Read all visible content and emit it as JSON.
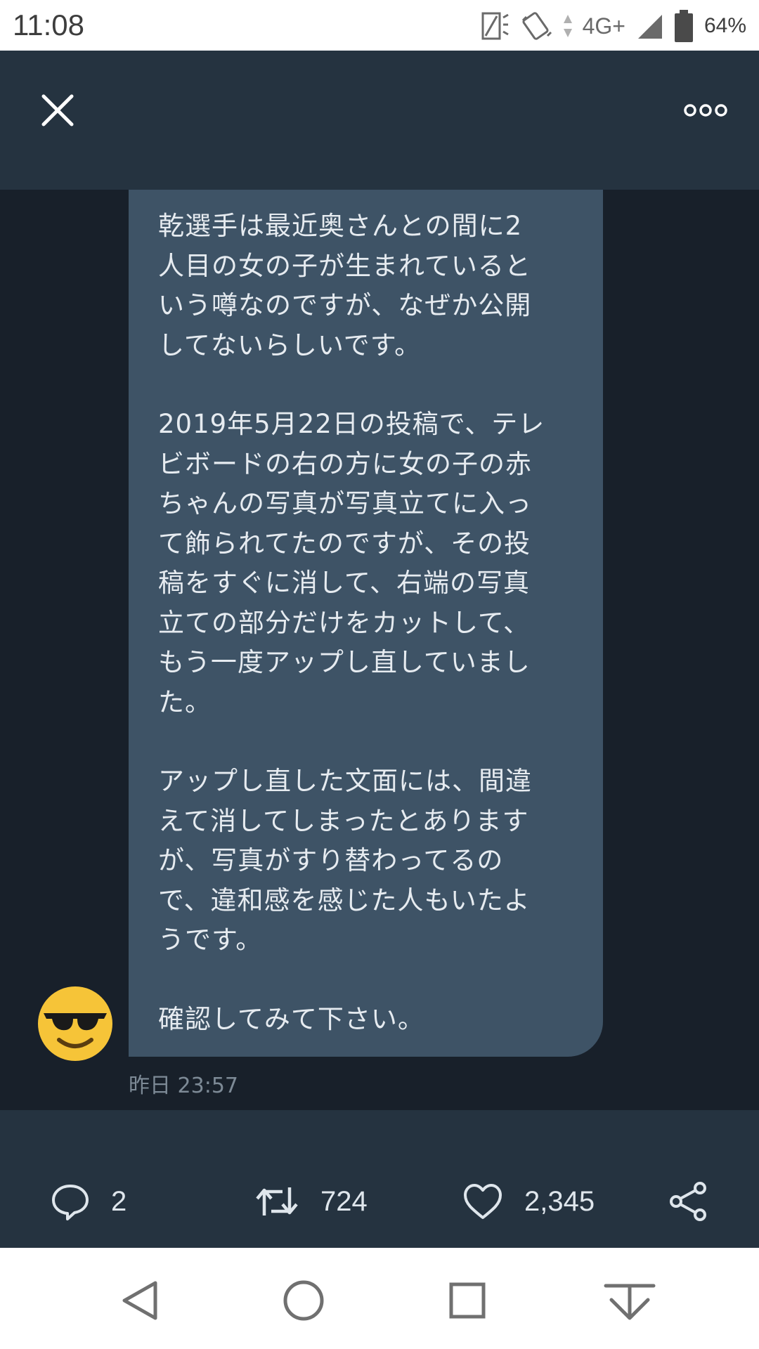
{
  "status_bar": {
    "time": "11:08",
    "network": "4G+",
    "battery_percent": "64%"
  },
  "header": {
    "close_icon": "close-icon",
    "more_icon": "more-horizontal-icon"
  },
  "message": {
    "paragraphs": [
      "乾選手は最近奥さんとの間に2\n人目の女の子が生まれていると\nいう噂なのですが、なぜか公開\nしてないらしいです。",
      "2019年5月22日の投稿で、テレ\nビボードの右の方に女の子の赤\nちゃんの写真が写真立てに入っ\nて飾られてたのですが、その投\n稿をすぐに消して、右端の写真\n立ての部分だけをカットして、\nもう一度アップし直していまし\nた。",
      "アップし直した文面には、間違\nえて消してしまったとあります\nが、写真がすり替わってるの\nで、違和感を感じた人もいたよ\nうです。",
      "確認してみて下さい。"
    ],
    "timestamp": "昨日 23:57",
    "avatar_icon": "sunglasses-emoji-icon"
  },
  "actions": {
    "reply_count": "2",
    "retweet_count": "724",
    "like_count": "2,345"
  },
  "colors": {
    "bubble": "#3e5366",
    "background": "#18202a",
    "bar": "#253340"
  }
}
